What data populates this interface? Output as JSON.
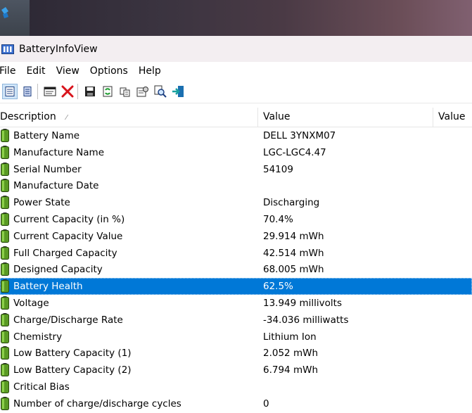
{
  "window": {
    "title": "BatteryInfoView"
  },
  "menu": [
    "File",
    "Edit",
    "View",
    "Options",
    "Help"
  ],
  "toolbar": [
    {
      "icon": "details-view-icon",
      "pressed": true
    },
    {
      "icon": "list-view-icon",
      "pressed": false
    },
    {
      "sep": true
    },
    {
      "icon": "log-window-icon",
      "pressed": false
    },
    {
      "icon": "delete-icon",
      "pressed": false
    },
    {
      "sep": true
    },
    {
      "icon": "save-icon",
      "pressed": false
    },
    {
      "icon": "refresh-icon",
      "pressed": false
    },
    {
      "icon": "copy-icon",
      "pressed": false
    },
    {
      "icon": "properties-icon",
      "pressed": false
    },
    {
      "icon": "find-icon",
      "pressed": false
    },
    {
      "icon": "exit-icon",
      "pressed": false
    }
  ],
  "columns": {
    "description": "Description",
    "value": "Value",
    "value2": "Value"
  },
  "rows": [
    {
      "desc": "Battery Name",
      "val": "DELL 3YNXM07"
    },
    {
      "desc": "Manufacture Name",
      "val": "LGC-LGC4.47"
    },
    {
      "desc": "Serial Number",
      "val": "54109"
    },
    {
      "desc": "Manufacture Date",
      "val": ""
    },
    {
      "desc": "Power State",
      "val": "Discharging"
    },
    {
      "desc": "Current Capacity (in %)",
      "val": "70.4%"
    },
    {
      "desc": "Current Capacity Value",
      "val": "29.914 mWh"
    },
    {
      "desc": "Full Charged Capacity",
      "val": "42.514 mWh"
    },
    {
      "desc": "Designed Capacity",
      "val": "68.005 mWh"
    },
    {
      "desc": "Battery Health",
      "val": "62.5%",
      "selected": true
    },
    {
      "desc": "Voltage",
      "val": "13.949 millivolts"
    },
    {
      "desc": "Charge/Discharge Rate",
      "val": "-34.036 milliwatts"
    },
    {
      "desc": "Chemistry",
      "val": "Lithium Ion"
    },
    {
      "desc": "Low Battery Capacity (1)",
      "val": "2.052 mWh"
    },
    {
      "desc": "Low Battery Capacity (2)",
      "val": "6.794 mWh"
    },
    {
      "desc": "Critical Bias",
      "val": ""
    },
    {
      "desc": "Number of charge/discharge cycles",
      "val": "0"
    }
  ],
  "colors": {
    "selection": "#0078d7",
    "battery_green": "#4c8a1e"
  }
}
